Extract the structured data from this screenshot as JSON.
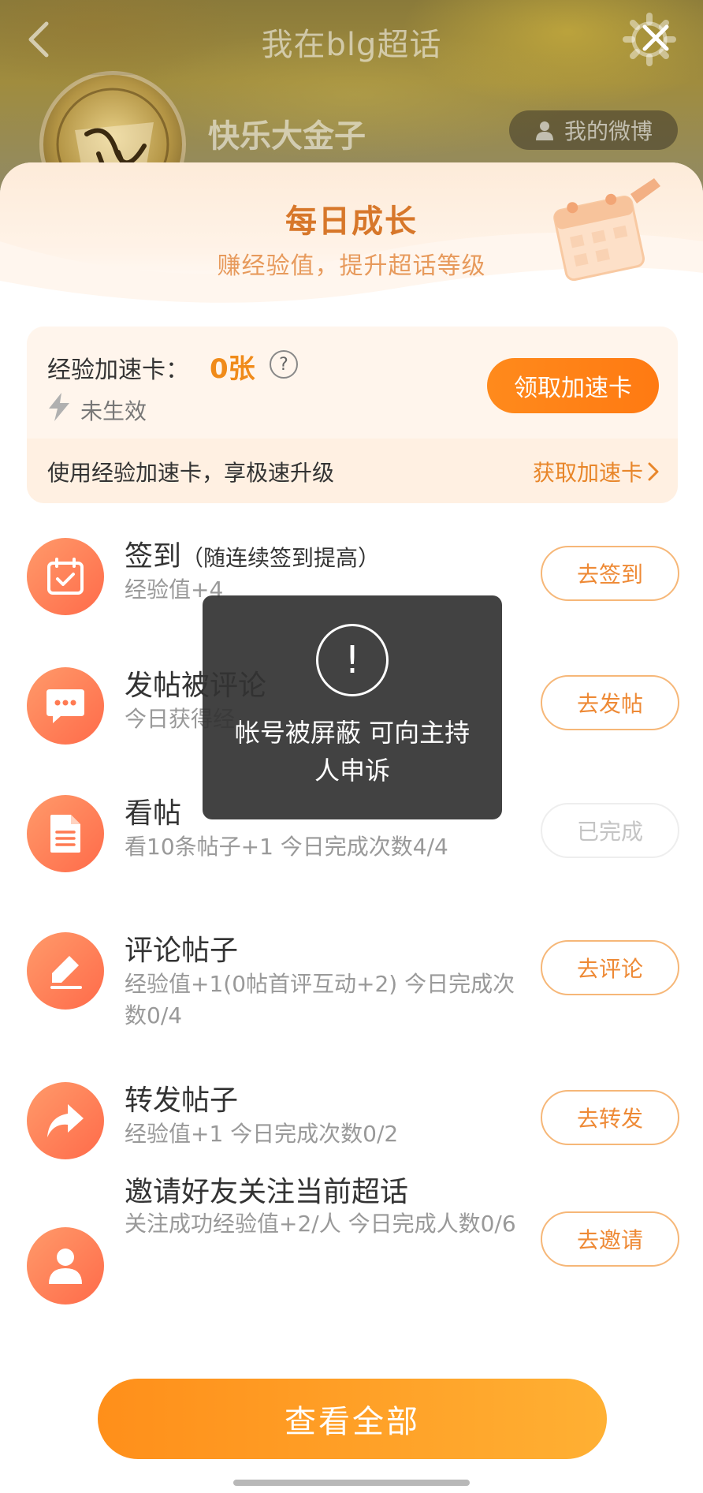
{
  "nav": {
    "title": "我在blg超话",
    "back_icon": "chevron-left-icon",
    "settings_icon": "gear-icon",
    "close_icon": "close-icon"
  },
  "profile": {
    "name": "快乐大金子",
    "avatar_text": "快乐大金子",
    "my_weibo_label": "我的微博"
  },
  "sheet": {
    "title": "每日成长",
    "subtitle": "赚经验值，提升超话等级"
  },
  "accel_card": {
    "label": "经验加速卡：",
    "count": "0张",
    "help": "?",
    "status": "未生效",
    "get_button": "领取加速卡",
    "description": "使用经验加速卡，享极速升级",
    "link_label": "获取加速卡"
  },
  "tasks": [
    {
      "title": "签到",
      "note": "（随连续签到提高）",
      "desc": "经验值+4",
      "button": "去签到",
      "done": false,
      "icon": "calendar-check-icon"
    },
    {
      "title": "发帖被评论",
      "note": "",
      "desc": "今日获得经",
      "button": "去发帖",
      "done": false,
      "icon": "chat-bubble-icon"
    },
    {
      "title": "看帖",
      "note": "",
      "desc": "看10条帖子+1   今日完成次数4/4",
      "button": "已完成",
      "done": true,
      "icon": "document-icon"
    },
    {
      "title": "评论帖子",
      "note": "",
      "desc": "经验值+1(0帖首评互动+2)  今日完成次数0/4",
      "button": "去评论",
      "done": false,
      "icon": "pencil-icon"
    },
    {
      "title": "转发帖子",
      "note": "",
      "desc": "经验值+1   今日完成次数0/2",
      "button": "去转发",
      "done": false,
      "icon": "share-arrow-icon"
    },
    {
      "title": "邀请好友关注当前超话",
      "note": "",
      "desc": "关注成功经验值+2/人   今日完成人数0/6",
      "button": "去邀请",
      "done": false,
      "icon": "user-icon"
    }
  ],
  "view_all_button": "查看全部",
  "toast": {
    "icon": "!",
    "message": "帐号被屏蔽 可向主持人申诉"
  },
  "colors": {
    "accent_orange": "#ff8a1c",
    "title_orange": "#d7772a",
    "icon_gradient_start": "#ff9a6a",
    "icon_gradient_end": "#ff6b4a",
    "toast_bg": "#323232"
  }
}
